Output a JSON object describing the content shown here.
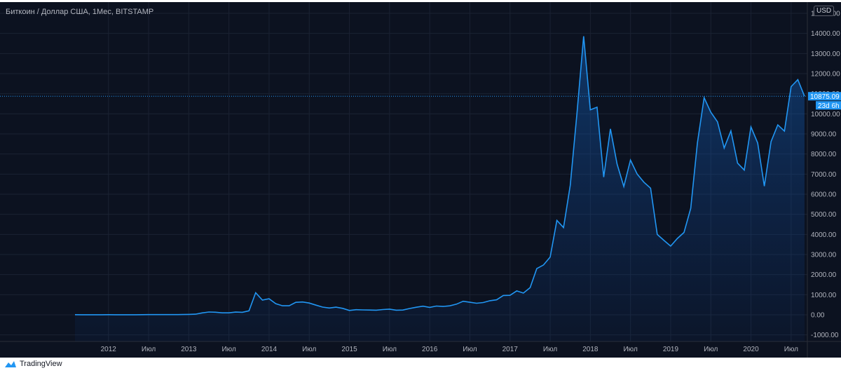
{
  "header": {
    "title": "Биткоин / Доллар США, 1Мес, BITSTAMP",
    "currency": "USD"
  },
  "footer": {
    "brand": "TradingView"
  },
  "colors": {
    "line": "#2196f3",
    "background": "#0c1220",
    "grid": "#1a2232"
  },
  "chart_data": {
    "type": "area",
    "title": "Биткоин / Доллар США, 1Мес, BITSTAMP",
    "start": "2011-08",
    "interval": "1 month",
    "values": [
      8,
      5,
      3,
      4,
      5,
      6,
      5,
      5,
      5,
      5,
      7,
      9,
      10,
      12,
      11,
      12,
      13,
      20,
      33,
      93,
      139,
      129,
      97,
      97,
      135,
      127,
      198,
      1100,
      732,
      800,
      550,
      450,
      450,
      620,
      640,
      585,
      480,
      385,
      340,
      380,
      320,
      217,
      254,
      244,
      236,
      230,
      263,
      284,
      231,
      236,
      314,
      378,
      430,
      370,
      437,
      416,
      448,
      531,
      673,
      624,
      575,
      609,
      700,
      745,
      964,
      970,
      1190,
      1080,
      1350,
      2300,
      2480,
      2875,
      4700,
      4340,
      6450,
      10000,
      13860,
      10200,
      10330,
      6850,
      9250,
      7500,
      6380,
      7700,
      7000,
      6600,
      6300,
      4000,
      3700,
      3420,
      3800,
      4100,
      5300,
      8550,
      10800,
      10080,
      9600,
      8300,
      9150,
      7550,
      7200,
      9350,
      8550,
      6400,
      8620,
      9450,
      9140,
      11350,
      11700,
      10875.09
    ],
    "ylim": [
      -1500,
      15500
    ],
    "y_ticks": [
      "-1000.00",
      "0.00",
      "1000.00",
      "2000.00",
      "3000.00",
      "4000.00",
      "5000.00",
      "6000.00",
      "7000.00",
      "8000.00",
      "9000.00",
      "10000.00",
      "11000.00",
      "12000.00",
      "13000.00",
      "14000.00",
      "15000.00"
    ],
    "x_ticks": [
      {
        "label": "2012",
        "month": "2012-01"
      },
      {
        "label": "Июл",
        "month": "2012-07"
      },
      {
        "label": "2013",
        "month": "2013-01"
      },
      {
        "label": "Июл",
        "month": "2013-07"
      },
      {
        "label": "2014",
        "month": "2014-01"
      },
      {
        "label": "Июл",
        "month": "2014-07"
      },
      {
        "label": "2015",
        "month": "2015-01"
      },
      {
        "label": "Июл",
        "month": "2015-07"
      },
      {
        "label": "2016",
        "month": "2016-01"
      },
      {
        "label": "Июл",
        "month": "2016-07"
      },
      {
        "label": "2017",
        "month": "2017-01"
      },
      {
        "label": "Июл",
        "month": "2017-07"
      },
      {
        "label": "2018",
        "month": "2018-01"
      },
      {
        "label": "Июл",
        "month": "2018-07"
      },
      {
        "label": "2019",
        "month": "2019-01"
      },
      {
        "label": "Июл",
        "month": "2019-07"
      },
      {
        "label": "2020",
        "month": "2020-01"
      },
      {
        "label": "Июл",
        "month": "2020-07"
      }
    ],
    "last_price": "10875.09",
    "last_value": 10875.09,
    "countdown": "23d 6h",
    "grid": true,
    "legend": "none"
  }
}
